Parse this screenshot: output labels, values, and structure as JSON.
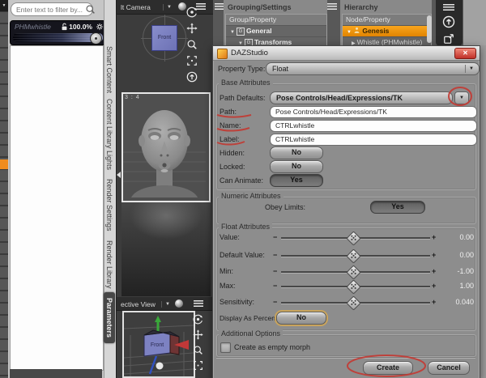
{
  "glyphs": {
    "down_arrow": "▼",
    "right_arrow": "▶",
    "minus": "−",
    "plus": "+",
    "close": "✕",
    "box_g": "G"
  },
  "left_panel": {
    "filter_placeholder": "Enter text to filter by...",
    "param_slider": {
      "name": "PHMwhistle",
      "value": "100.0%"
    }
  },
  "side_tabs": {
    "items": [
      {
        "label": "Smart Content"
      },
      {
        "label": "Content Library"
      },
      {
        "label": "Lights"
      },
      {
        "label": "Render Settings"
      },
      {
        "label": "Render Library"
      },
      {
        "label": "Parameters",
        "active": true
      }
    ]
  },
  "viewport": {
    "camera_selector": "lt Camera",
    "aspect_label": "3 : 4",
    "cube_face": "Front"
  },
  "bottom_viewport": {
    "view_selector": "ective View",
    "cube_face": "Front"
  },
  "grouping_panel": {
    "title": "Grouping/Settings",
    "column_header": "Group/Property",
    "rows": [
      {
        "label": "General"
      },
      {
        "label": "Transforms"
      }
    ]
  },
  "hierarchy_panel": {
    "title": "Hierarchy",
    "column_header": "Node/Property",
    "rows": [
      {
        "label": "Genesis",
        "selected": true
      },
      {
        "label": "Whistle (PHMwhistle)"
      }
    ],
    "selected_color": "#f8a51e"
  },
  "dialog": {
    "title": "DAZStudio",
    "property_type": {
      "label": "Property Type:",
      "value": "Float"
    },
    "sections": {
      "base": "Base Attributes",
      "numeric": "Numeric Attributes",
      "float": "Float Attributes",
      "additional": "Additional Options"
    },
    "path_defaults": {
      "label": "Path Defaults:",
      "value": "Pose Controls/Head/Expressions/TK"
    },
    "path": {
      "label": "Path:",
      "value": "Pose Controls/Head/Expressions/TK"
    },
    "name": {
      "label": "Name:",
      "value": "CTRLwhistle"
    },
    "label": {
      "label": "Label:",
      "value": "CTRLwhistle"
    },
    "hidden": {
      "label": "Hidden:",
      "value": "No"
    },
    "locked": {
      "label": "Locked:",
      "value": "No"
    },
    "can_animate": {
      "label": "Can Animate:",
      "value": "Yes"
    },
    "obey_limits": {
      "label": "Obey Limits:",
      "value": "Yes"
    },
    "sliders": [
      {
        "label": "Value:",
        "value": "0.00"
      },
      {
        "label": "Default Value:",
        "value": "0.00"
      },
      {
        "label": "Min:",
        "value": "-1.00"
      },
      {
        "label": "Max:",
        "value": "1.00"
      },
      {
        "label": "Sensitivity:",
        "value": "0.040"
      }
    ],
    "display_as_percent": {
      "label": "Display As Percent:",
      "value": "No"
    },
    "create_empty_morph_label": "Create as empty morph",
    "buttons": {
      "create": "Create",
      "cancel": "Cancel"
    },
    "annotation_color": "#c23b34"
  }
}
